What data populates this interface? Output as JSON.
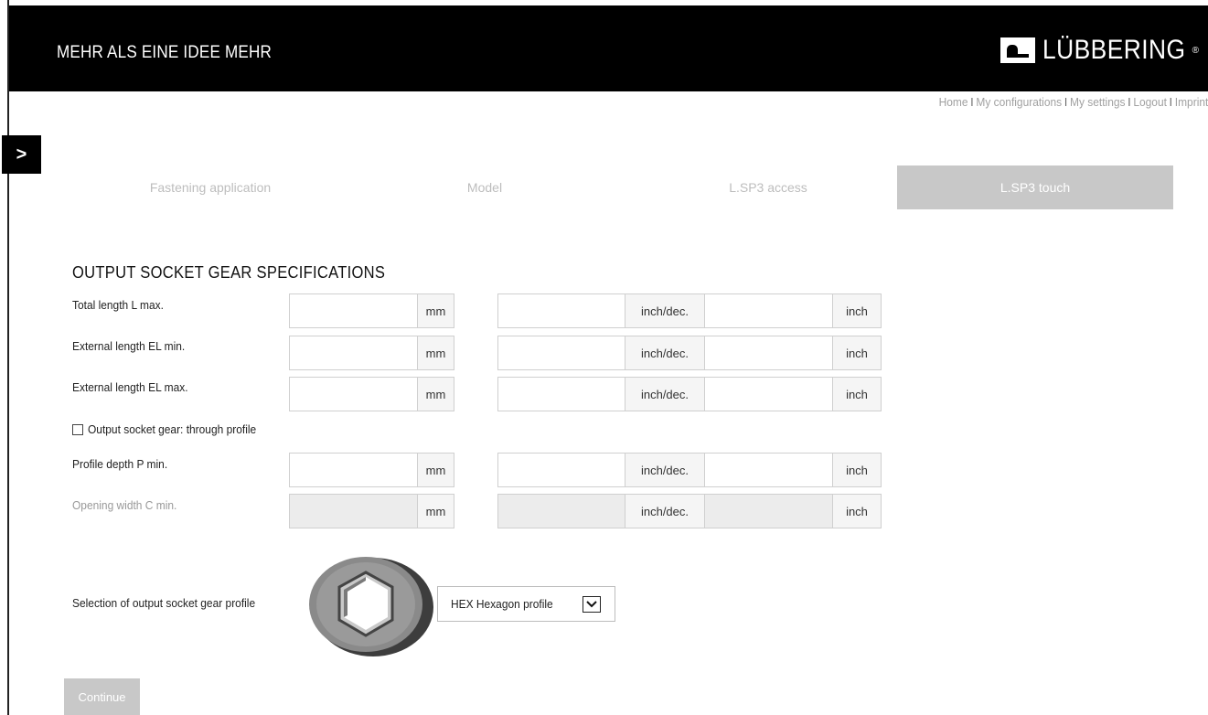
{
  "header": {
    "slogan": "MEHR ALS EINE IDEE MEHR",
    "logo_text": "LÜBBERING",
    "logo_reg": "®"
  },
  "topnav": {
    "items": [
      "Home",
      "My configurations",
      "My settings",
      "Logout",
      "Imprint"
    ],
    "separator": "I"
  },
  "sidebar_toggle": {
    "label": ">"
  },
  "steps": [
    {
      "label": "Fastening application",
      "active": false
    },
    {
      "label": "Model",
      "active": false
    },
    {
      "label": "L.SP3 access",
      "active": false
    },
    {
      "label": "L.SP3 touch",
      "active": true
    }
  ],
  "section": {
    "title": "OUTPUT SOCKET GEAR SPECIFICATIONS"
  },
  "units": {
    "mm": "mm",
    "inch_dec": "inch/dec.",
    "inch": "inch"
  },
  "rows": [
    {
      "label": "Total length L max.",
      "mm_value": "",
      "inch_dec_value": "",
      "inch_value": "",
      "disabled": false
    },
    {
      "label": "External length EL min.",
      "mm_value": "",
      "inch_dec_value": "",
      "inch_value": "",
      "disabled": false
    },
    {
      "label": "External length EL max.",
      "mm_value": "",
      "inch_dec_value": "",
      "inch_value": "",
      "disabled": false
    },
    {
      "label": "Profile depth P min.",
      "mm_value": "",
      "inch_dec_value": "",
      "inch_value": "",
      "disabled": false
    },
    {
      "label": "Opening width C min.",
      "mm_value": "",
      "inch_dec_value": "",
      "inch_value": "",
      "disabled": true
    }
  ],
  "through_profile": {
    "label": "Output socket gear: through profile",
    "checked": false
  },
  "profile_selection": {
    "label": "Selection of output socket gear profile",
    "selected": "HEX Hexagon profile"
  },
  "continue_button": {
    "label": "Continue"
  },
  "colors": {
    "header_bg": "#000000",
    "active_step": "#c8c8c8",
    "disabled_field": "#ececec"
  }
}
